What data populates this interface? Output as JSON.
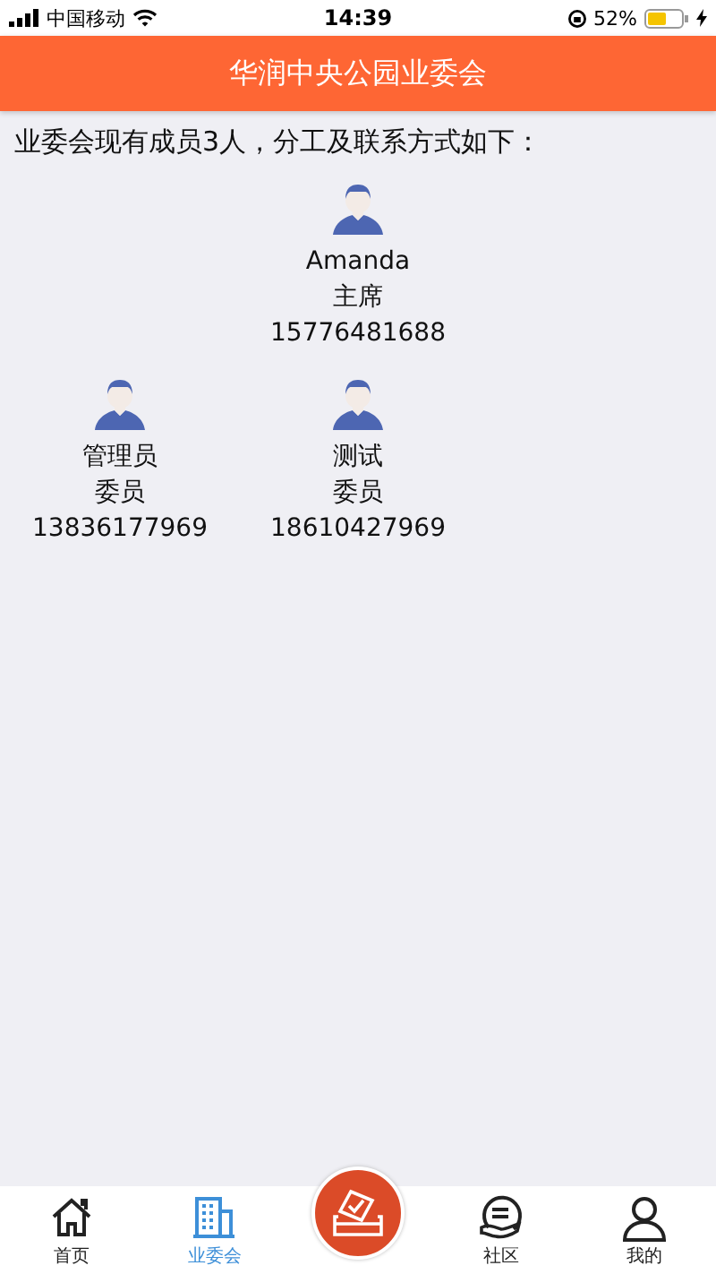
{
  "status_bar": {
    "carrier": "中国移动",
    "time": "14:39",
    "battery": "52%"
  },
  "header": {
    "title": "华润中央公园业委会"
  },
  "intro": "业委会现有成员3人，分工及联系方式如下：",
  "member_rows": [
    {
      "kind": "centered",
      "members": [
        {
          "name": "Amanda",
          "role": "主席",
          "phone": "15776481688"
        }
      ]
    },
    {
      "kind": "left",
      "members": [
        {
          "name": "管理员",
          "role": "委员",
          "phone": "13836177969"
        },
        {
          "name": "测试",
          "role": "委员",
          "phone": "18610427969"
        }
      ]
    }
  ],
  "tab_bar": [
    {
      "kind": "home",
      "label": "首页",
      "selected": false
    },
    {
      "kind": "building",
      "label": "业委会",
      "selected": true
    },
    {
      "kind": "vote"
    },
    {
      "kind": "community",
      "label": "社区",
      "selected": false
    },
    {
      "kind": "person",
      "label": "我的",
      "selected": false
    }
  ]
}
